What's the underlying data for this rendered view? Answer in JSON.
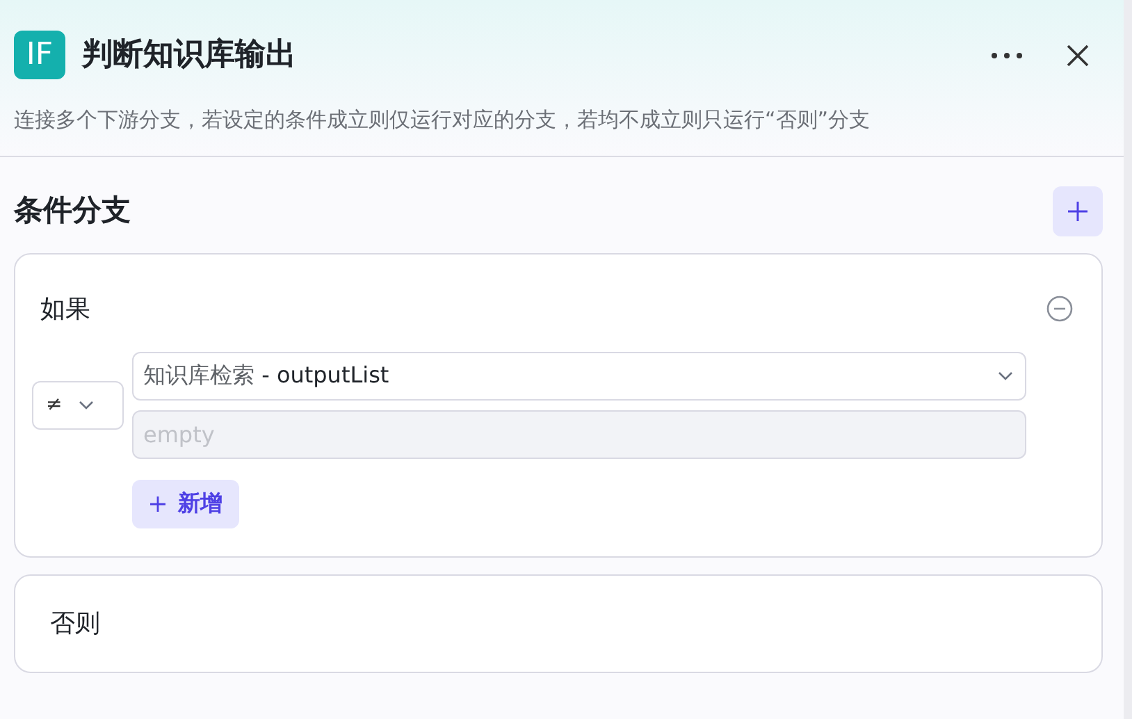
{
  "header": {
    "icon_text": "IF",
    "title": "判断知识库输出",
    "description": "连接多个下游分支，若设定的条件成立则仅运行对应的分支，若均不成立则只运行“否则”分支"
  },
  "section": {
    "title": "条件分支"
  },
  "branches": [
    {
      "kind": "if",
      "label": "如果",
      "conditions": [
        {
          "operator": "≠",
          "variable_source": "知识库检索",
          "variable_separator": "-",
          "variable_name": "outputList",
          "value_placeholder": "empty",
          "value_disabled": true
        }
      ],
      "add_label": "新增"
    },
    {
      "kind": "else",
      "label": "否则"
    }
  ]
}
